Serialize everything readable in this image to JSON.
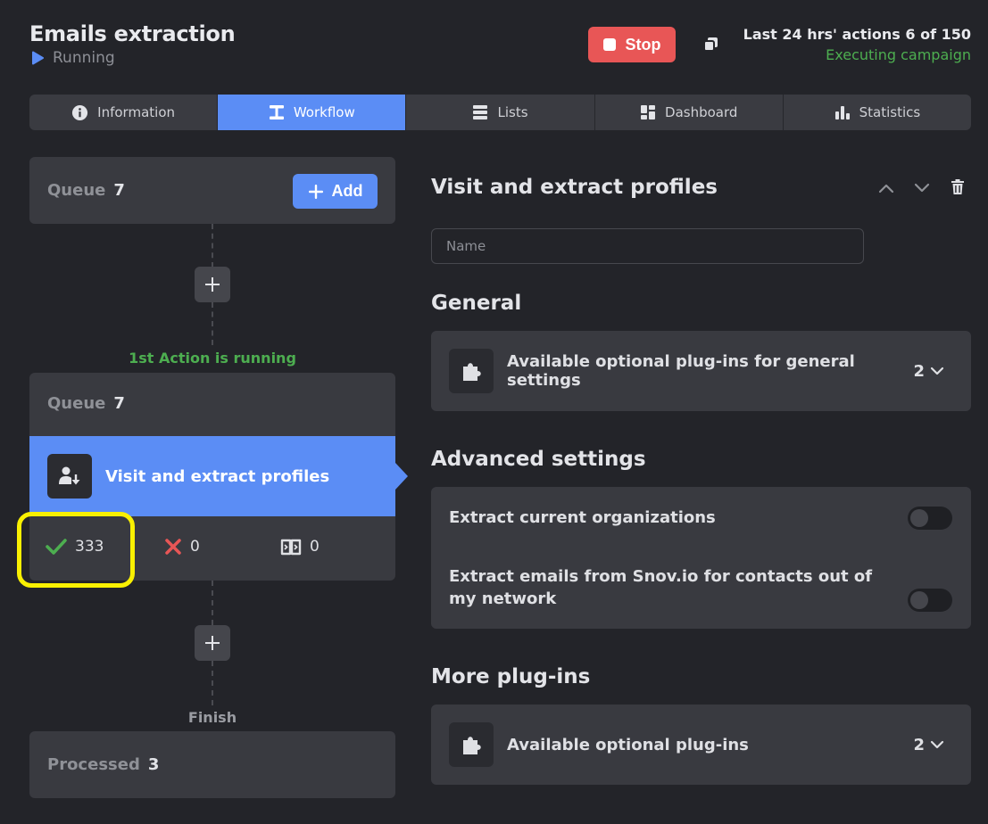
{
  "header": {
    "title": "Emails extraction",
    "status": "Running",
    "stop_label": "Stop",
    "actions_text": "Last 24 hrs' actions 6 of 150",
    "executing_text": "Executing campaign"
  },
  "tabs": [
    {
      "label": "Information",
      "icon": "info-icon"
    },
    {
      "label": "Workflow",
      "icon": "workflow-icon",
      "active": true
    },
    {
      "label": "Lists",
      "icon": "list-icon"
    },
    {
      "label": "Dashboard",
      "icon": "dashboard-icon"
    },
    {
      "label": "Statistics",
      "icon": "statistics-icon"
    }
  ],
  "workflow": {
    "start_queue": {
      "label": "Queue",
      "count": "7"
    },
    "add_label": "Add",
    "running_label": "1st Action is running",
    "action_queue": {
      "label": "Queue",
      "count": "7"
    },
    "action_title": "Visit and extract profiles",
    "stats": {
      "success": "333",
      "failed": "0",
      "skipped": "0"
    },
    "finish_label": "Finish",
    "processed": {
      "label": "Processed",
      "count": "3"
    }
  },
  "panel": {
    "title": "Visit and extract profiles",
    "name_placeholder": "Name",
    "general_title": "General",
    "general_plugin_text": "Available optional plug-ins for general settings",
    "general_plugin_count": "2",
    "advanced_title": "Advanced settings",
    "settings": [
      {
        "label": "Extract current organizations",
        "enabled": false
      },
      {
        "label": "Extract emails from Snov.io for contacts out of my network",
        "enabled": false
      }
    ],
    "more_title": "More plug-ins",
    "more_plugin_text": "Available optional plug-ins",
    "more_plugin_count": "2"
  },
  "colors": {
    "accent": "#5b8df5",
    "stop": "#e85656",
    "success": "#4dae50",
    "highlight": "#f9f002",
    "background": "#232429"
  }
}
